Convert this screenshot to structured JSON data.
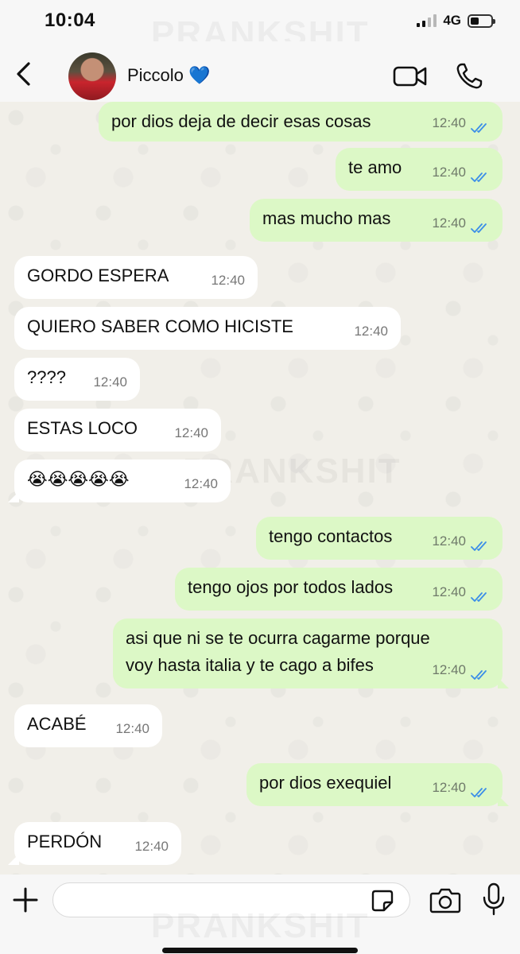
{
  "status_bar": {
    "time": "10:04",
    "network": "4G",
    "battery_level": 0.4
  },
  "header": {
    "contact_name": "Piccolo 💙"
  },
  "watermark": "PRANKSHIT",
  "messages": [
    {
      "direction": "out",
      "text": "por dios deja de decir esas cosas",
      "time": "12:40",
      "read": true
    },
    {
      "direction": "out",
      "text": "te amo",
      "time": "12:40",
      "read": true
    },
    {
      "direction": "out",
      "text": "mas mucho mas",
      "time": "12:40",
      "read": true
    },
    {
      "direction": "in",
      "text": "GORDO ESPERA",
      "time": "12:40"
    },
    {
      "direction": "in",
      "text": "QUIERO SABER COMO HICISTE",
      "time": "12:40"
    },
    {
      "direction": "in",
      "text": "????",
      "time": "12:40"
    },
    {
      "direction": "in",
      "text": "ESTAS LOCO",
      "time": "12:40"
    },
    {
      "direction": "in",
      "text": "😭😭😭😭😭",
      "time": "12:40"
    },
    {
      "direction": "out",
      "text": "tengo contactos",
      "time": "12:40",
      "read": true
    },
    {
      "direction": "out",
      "text": "tengo ojos por todos lados",
      "time": "12:40",
      "read": true
    },
    {
      "direction": "out",
      "text": "asi que ni se te ocurra cagarme porque\nvoy hasta italia y te cago a bifes",
      "time": "12:40",
      "read": true
    },
    {
      "direction": "in",
      "text": "ACABÉ",
      "time": "12:40"
    },
    {
      "direction": "out",
      "text": "por dios exequiel",
      "time": "12:40",
      "read": true
    },
    {
      "direction": "in",
      "text": "PERDÓN",
      "time": "12:40"
    }
  ],
  "composer": {
    "input_value": "",
    "placeholder": ""
  },
  "colors": {
    "outgoing_bubble": "#dcf8c6",
    "incoming_bubble": "#ffffff",
    "read_ticks": "#3b8ee8"
  }
}
